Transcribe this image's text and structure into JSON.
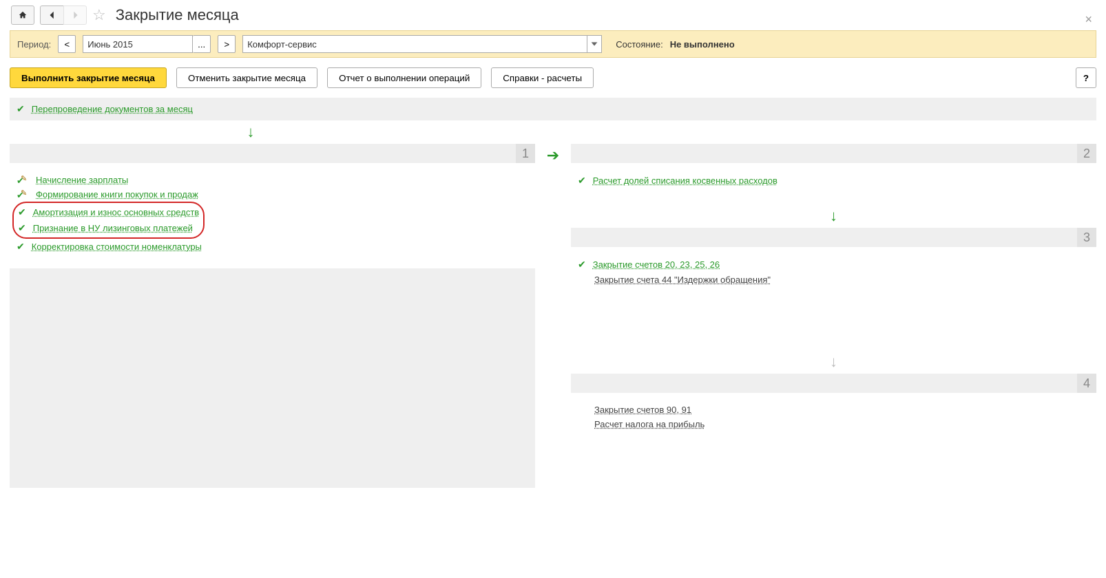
{
  "header": {
    "title": "Закрытие месяца"
  },
  "period_bar": {
    "label": "Период:",
    "prev": "<",
    "period_value": "Июнь 2015",
    "more": "...",
    "next": ">",
    "org_value": "Комфорт-сервис",
    "state_label": "Состояние:",
    "state_value": "Не выполнено"
  },
  "actions": {
    "run": "Выполнить закрытие месяца",
    "cancel": "Отменить закрытие месяца",
    "report": "Отчет о выполнении операций",
    "refs": "Справки - расчеты",
    "help": "?"
  },
  "top_step": {
    "label": "Перепроведение документов за месяц"
  },
  "block1": {
    "num": "1",
    "items": [
      {
        "label": "Начисление зарплаты",
        "icon": "pencil"
      },
      {
        "label": "Формирование книги покупок и продаж",
        "icon": "pencil"
      },
      {
        "label": "Амортизация и износ основных средств",
        "icon": "check",
        "hl": true
      },
      {
        "label": "Признание в НУ лизинговых платежей",
        "icon": "check",
        "hl": true
      },
      {
        "label": "Корректировка стоимости номенклатуры",
        "icon": "check"
      }
    ]
  },
  "block2": {
    "num": "2",
    "items": [
      {
        "label": "Расчет долей списания косвенных расходов",
        "icon": "check",
        "green": true
      }
    ]
  },
  "block3": {
    "num": "3",
    "items": [
      {
        "label": "Закрытие счетов 20, 23, 25, 26",
        "icon": "check",
        "green": true
      },
      {
        "label": "Закрытие счета 44 \"Издержки обращения\"",
        "icon": "none",
        "green": false
      }
    ]
  },
  "block4": {
    "num": "4",
    "items": [
      {
        "label": "Закрытие счетов 90, 91",
        "icon": "none",
        "green": false
      },
      {
        "label": "Расчет налога на прибыль",
        "icon": "none",
        "green": false
      }
    ]
  }
}
